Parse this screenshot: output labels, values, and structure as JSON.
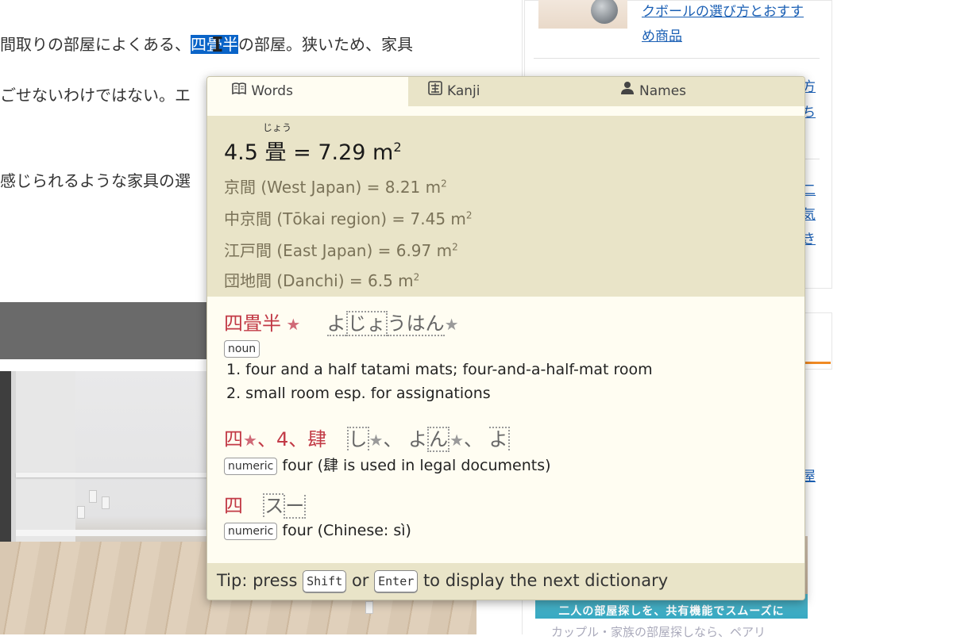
{
  "article": {
    "line1_before": "間取りの部屋によくある、",
    "line1_selected": "四畳半",
    "line1_after": "の部屋。狭いため、家具",
    "line2": "ごせないわけではない。エ",
    "line3": "感じられるような家具の選"
  },
  "sidebar": {
    "link1_line1": "クボールの選び方とおすす",
    "link1_line2": "め商品",
    "frag_a": "方",
    "frag_b": "ち",
    "frag_c": "二",
    "frag_d": "気",
    "frag_e": "き",
    "frag_f": "屋",
    "banner_text": "二人の部屋探しを、共有機能でスムーズに",
    "bottom_text": "カップル・家族の部屋探しなら、ペアリ"
  },
  "popup": {
    "tabs": [
      {
        "label": "Words",
        "icon": "book-icon"
      },
      {
        "label": "Kanji",
        "icon": "kanji-icon"
      },
      {
        "label": "Names",
        "icon": "person-icon"
      }
    ],
    "metric": {
      "ruby": "じょう",
      "value": "4.5",
      "unit_kanji": "畳",
      "equals": "= 7.29 m",
      "exp": "2",
      "rows": [
        {
          "text": "京間 (West Japan) = 8.21 m",
          "exp": "2"
        },
        {
          "text": "中京間 (Tōkai region) = 7.45 m",
          "exp": "2"
        },
        {
          "text": "江戸間 (East Japan) = 6.97 m",
          "exp": "2"
        },
        {
          "text": "団地間 (Danchi) = 6.5 m",
          "exp": "2"
        }
      ]
    },
    "entries": [
      {
        "headword": "四畳半",
        "reading_parts": [
          "よ",
          "じょ",
          "うはん"
        ],
        "pos": "noun",
        "senses": [
          "1. four and a half tatami mats; four-and-a-half-mat room",
          "2. small room esp. for assignations"
        ]
      },
      {
        "headword_a": "四",
        "sep1": "、",
        "headword_b": "4",
        "sep2": "、",
        "headword_c": "肆",
        "reading_a": "し",
        "reading_sep": "、",
        "reading_b_1": "よ",
        "reading_b_2": "ん",
        "reading_sep2": "、",
        "reading_c": "よ",
        "pos": "numeric",
        "gloss": "four (肆 is used in legal documents)"
      },
      {
        "headword": "四",
        "reading_1": "ス",
        "reading_2": "ー",
        "pos": "numeric",
        "gloss": "four (Chinese: sì)"
      }
    ],
    "tip": {
      "prefix": "Tip: press",
      "key1": "Shift",
      "mid": "or",
      "key2": "Enter",
      "suffix": "to display the next dictionary"
    }
  },
  "colors": {
    "headword_red": "#c23a46",
    "popup_bg": "#fffdf2",
    "popup_band": "#e9e4c8",
    "selection_blue": "#0a64c8",
    "link_blue": "#1a5fb4"
  }
}
